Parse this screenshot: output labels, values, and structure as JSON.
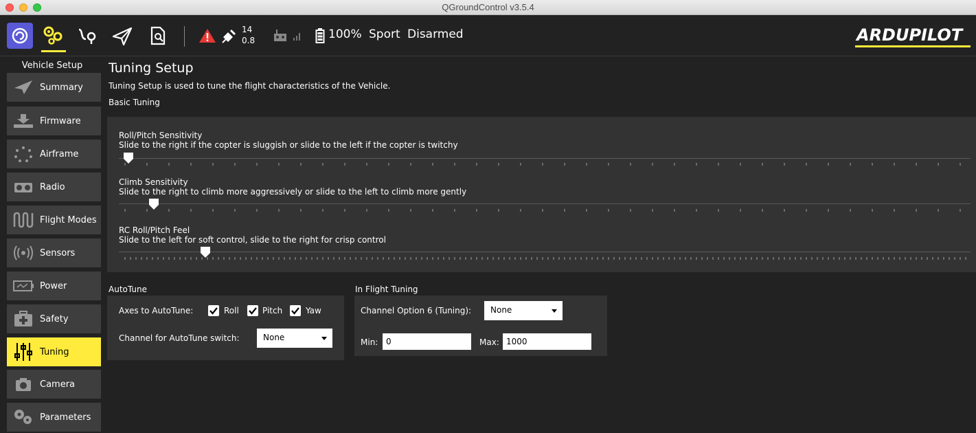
{
  "window": {
    "title": "QGroundControl v3.5.4"
  },
  "toolbar": {
    "gps_count": "14",
    "gps_hdop": "0.8",
    "battery_percent": "100%",
    "flight_mode": "Sport",
    "arm_status": "Disarmed",
    "brand": "ARDUPILOT",
    "accent_color": "#ffeb3b"
  },
  "sidebar": {
    "header": "Vehicle Setup",
    "items": [
      {
        "label": "Summary",
        "icon": "paper-plane-icon"
      },
      {
        "label": "Firmware",
        "icon": "download-icon"
      },
      {
        "label": "Airframe",
        "icon": "airframe-icon"
      },
      {
        "label": "Radio",
        "icon": "radio-icon"
      },
      {
        "label": "Flight Modes",
        "icon": "waveform-icon"
      },
      {
        "label": "Sensors",
        "icon": "sensors-icon"
      },
      {
        "label": "Power",
        "icon": "power-icon"
      },
      {
        "label": "Safety",
        "icon": "first-aid-icon"
      },
      {
        "label": "Tuning",
        "icon": "sliders-icon",
        "active": true
      },
      {
        "label": "Camera",
        "icon": "camera-icon"
      },
      {
        "label": "Parameters",
        "icon": "gears-icon"
      }
    ]
  },
  "page": {
    "title": "Tuning Setup",
    "description": "Tuning Setup is used to tune the flight characteristics of the Vehicle.",
    "basic_label": "Basic Tuning"
  },
  "sliders": [
    {
      "title": "Roll/Pitch Sensitivity",
      "description": "Slide to the right if the copter is sluggish or slide to the left if the copter is twitchy",
      "position_fraction": 0.005
    },
    {
      "title": "Climb Sensitivity",
      "description": "Slide to the right to climb more aggressively or slide to the left to climb more gently",
      "position_fraction": 0.035
    },
    {
      "title": "RC Roll/Pitch Feel",
      "description": "Slide to the left for soft control, slide to the right for crisp control",
      "position_fraction": 0.095
    }
  ],
  "autotune": {
    "label": "AutoTune",
    "axes_label": "Axes to AutoTune:",
    "axes": [
      {
        "label": "Roll",
        "checked": true
      },
      {
        "label": "Pitch",
        "checked": true
      },
      {
        "label": "Yaw",
        "checked": true
      }
    ],
    "channel_label": "Channel for AutoTune switch:",
    "channel_value": "None"
  },
  "inflight": {
    "label": "In Flight Tuning",
    "channel_label": "Channel Option 6 (Tuning):",
    "channel_value": "None",
    "min_label": "Min:",
    "min_value": "0",
    "max_label": "Max:",
    "max_value": "1000"
  }
}
